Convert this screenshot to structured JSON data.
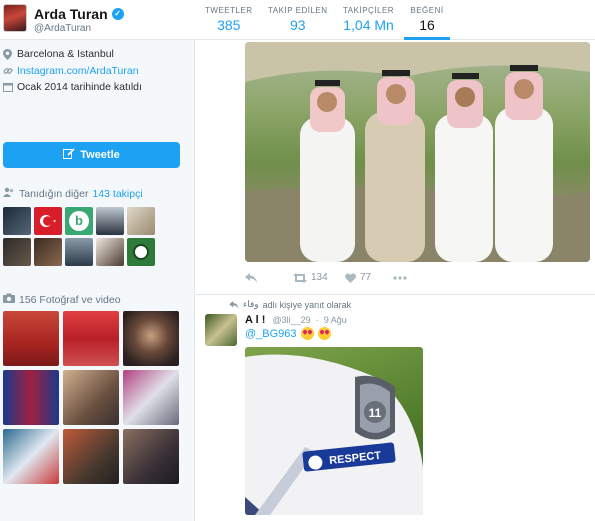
{
  "profile": {
    "name": "Arda Turan",
    "handle": "@ArdaTuran"
  },
  "stats": [
    {
      "label": "TWEETLER",
      "value": "385"
    },
    {
      "label": "TAKİP EDİLEN",
      "value": "93"
    },
    {
      "label": "TAKİPÇİLER",
      "value": "1,04 Mn"
    },
    {
      "label": "BEĞENİ",
      "value": "16"
    }
  ],
  "bio": {
    "location": "Barcelona & Istanbul",
    "website": "Instagram.com/ArdaTuran",
    "joined": "Ocak 2014 tarihinde katıldı"
  },
  "tweet_button": "Tweetle",
  "followers_section": {
    "prefix": "Tanıdığın diğer",
    "count_text": "143 takipçi"
  },
  "media_section": {
    "label": "156 Fotoğraf ve video"
  },
  "tweet1_actions": {
    "retweets": "134",
    "likes": "77"
  },
  "reply_context": {
    "user": "وفاء",
    "text": "adlı kişiye yanıt olarak"
  },
  "tweet2": {
    "name": "A l !",
    "handle": "@3li__29",
    "date": "9 Ağu",
    "mention": "@_BG963"
  },
  "photo2": {
    "badge_number": "11",
    "patch_text": "RESPECT"
  },
  "colors": {
    "accent": "#1da1f2",
    "text": "#292f33",
    "muted": "#657786"
  }
}
